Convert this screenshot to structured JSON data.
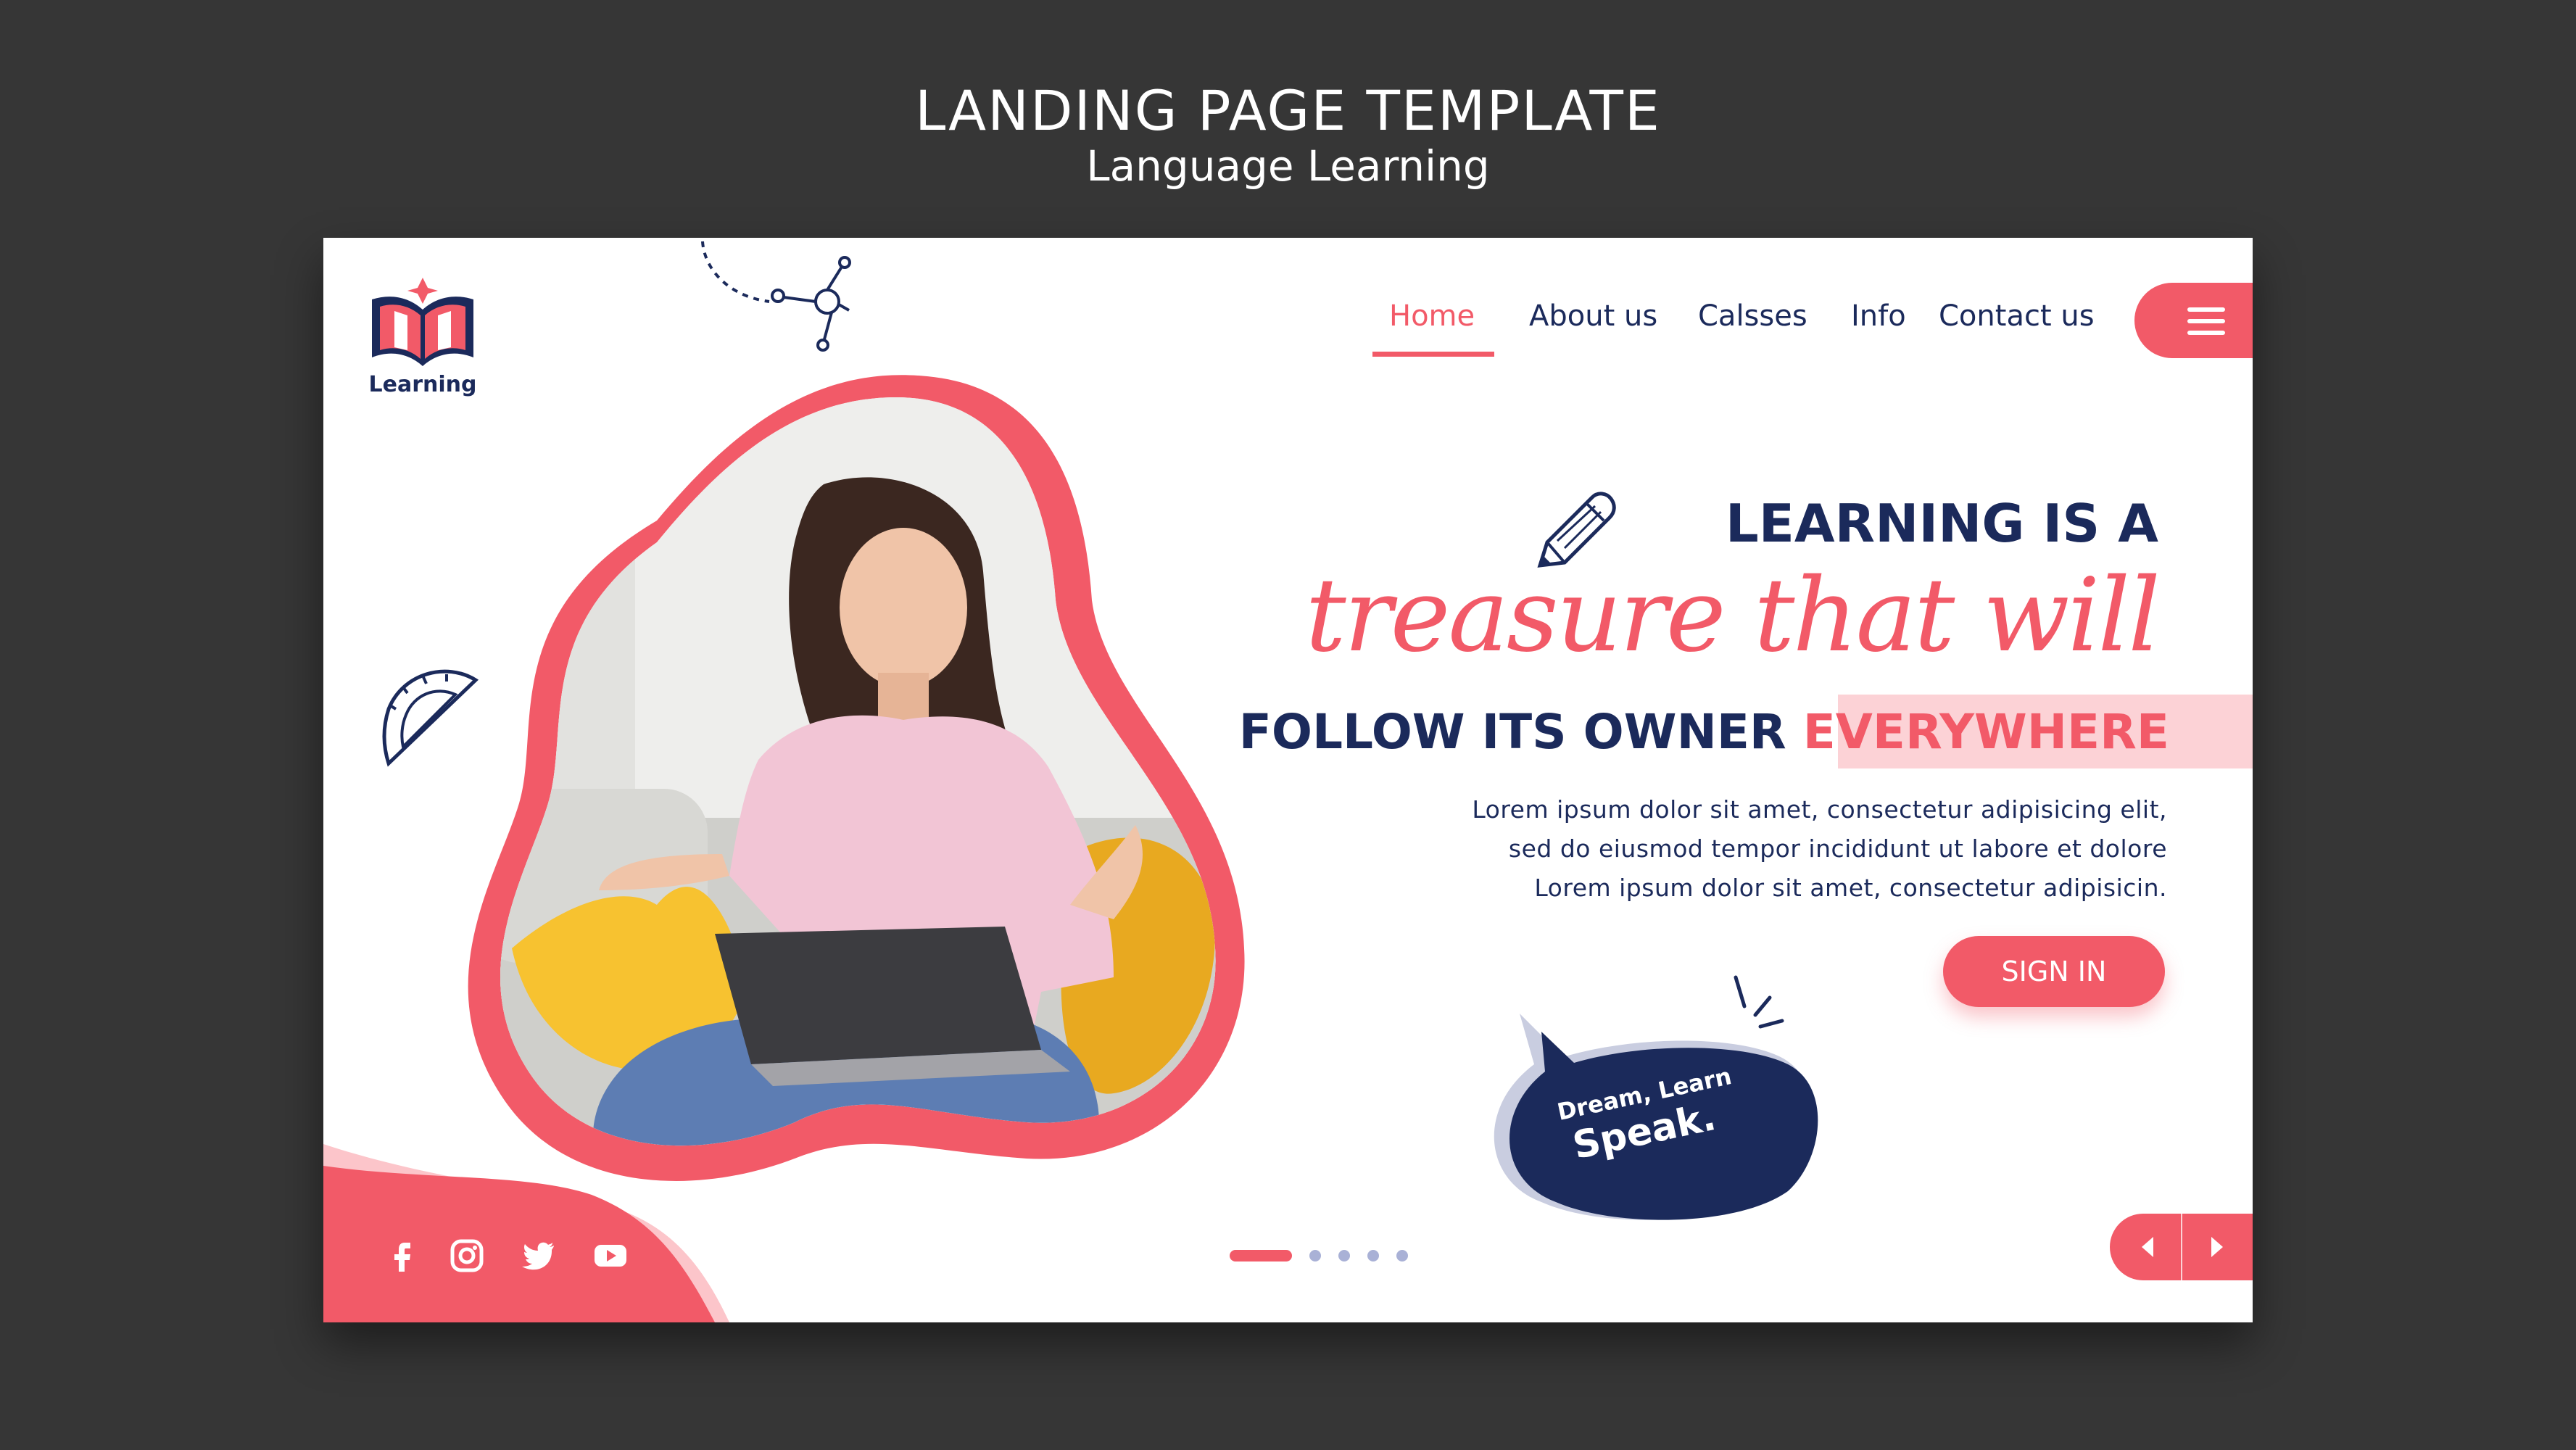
{
  "header": {
    "title": "LANDING PAGE TEMPLATE",
    "subtitle": "Language Learning"
  },
  "logo": {
    "text": "Learning",
    "icon": "book-icon"
  },
  "nav": {
    "items": [
      {
        "label": "Home",
        "active": true
      },
      {
        "label": "About us",
        "active": false
      },
      {
        "label": "Calsses",
        "active": false
      },
      {
        "label": "Info",
        "active": false
      },
      {
        "label": "Contact us",
        "active": false
      }
    ],
    "menu_icon": "hamburger-menu-icon"
  },
  "hero": {
    "line1": "LEARNING IS A",
    "line2": "treasure that will",
    "line3_main": "FOLLOW ITS OWNER",
    "line3_highlight": "EVERYWHERE",
    "body": [
      "Lorem ipsum dolor sit amet, consectetur adipisicing elit,",
      "sed do eiusmod tempor incididunt ut labore et dolore",
      "Lorem ipsum dolor sit amet, consectetur adipisicin."
    ],
    "cta_label": "SIGN IN"
  },
  "speech_bubble": {
    "line1": "Dream, Learn",
    "line2": "Speak."
  },
  "social": [
    "facebook-icon",
    "instagram-icon",
    "twitter-icon",
    "youtube-icon"
  ],
  "carousel": {
    "total": 5,
    "active_index": 0,
    "prev_icon": "chevron-left-icon",
    "next_icon": "chevron-right-icon"
  },
  "colors": {
    "background": "#363636",
    "accent": "#f25a68",
    "navy": "#1b2a5b",
    "highlight": "#fcd2d6",
    "dot_inactive": "#a9b1d6"
  }
}
